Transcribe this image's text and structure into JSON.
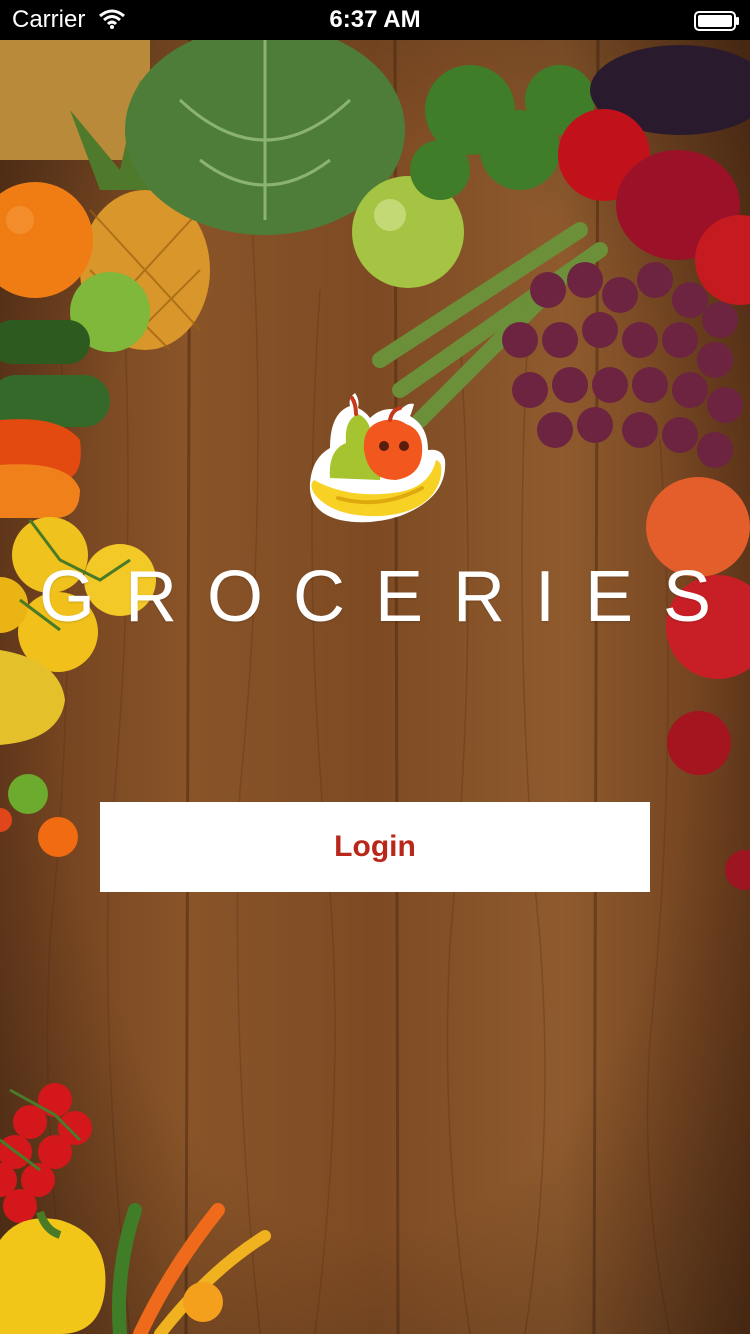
{
  "status_bar": {
    "carrier": "Carrier",
    "time": "6:37 AM"
  },
  "brand": {
    "title": "GROCERIES"
  },
  "login": {
    "label": "Login"
  },
  "icons": {
    "wifi": "wifi-icon",
    "battery": "battery-icon",
    "logo": "fruit-basket-logo"
  },
  "colors": {
    "status_bar_bg": "#000000",
    "wood": "#7a4a24",
    "button_bg": "#ffffff",
    "button_text": "#b9261a",
    "title_text": "#ffffff"
  }
}
